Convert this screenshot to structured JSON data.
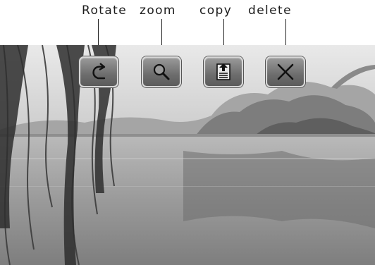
{
  "toolbar": {
    "buttons": [
      {
        "label": "Rotate",
        "icon": "rotate-icon"
      },
      {
        "label": "zoom",
        "icon": "magnifier-icon"
      },
      {
        "label": "copy",
        "icon": "copy-icon"
      },
      {
        "label": "delete",
        "icon": "close-icon"
      }
    ]
  },
  "colors": {
    "button_face": "#6d6d6d",
    "button_border": "#d8d8d8",
    "icon_stroke": "#111111"
  }
}
